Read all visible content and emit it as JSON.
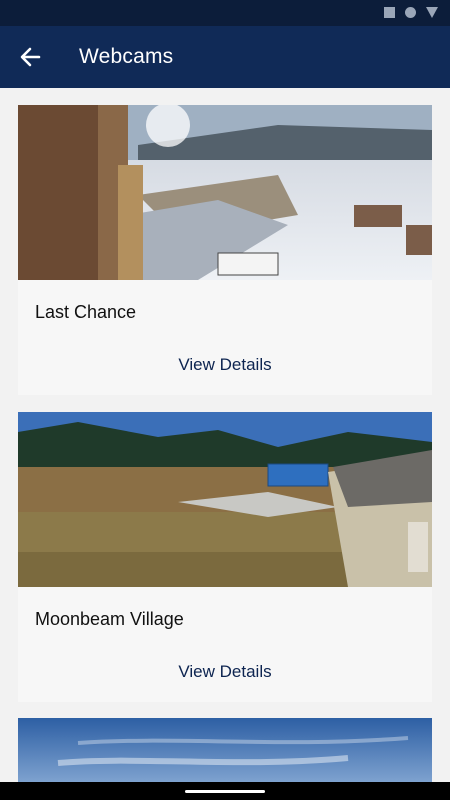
{
  "app_bar": {
    "title": "Webcams"
  },
  "webcams": [
    {
      "name": "Last Chance",
      "action_label": "View Details"
    },
    {
      "name": "Moonbeam Village",
      "action_label": "View Details"
    }
  ],
  "colors": {
    "app_bar": "#102a57",
    "status_bar": "#0c1d3a",
    "action_text": "#0d2450",
    "background": "#f2f2f2"
  },
  "icons": {
    "back": "arrow-left-icon"
  }
}
